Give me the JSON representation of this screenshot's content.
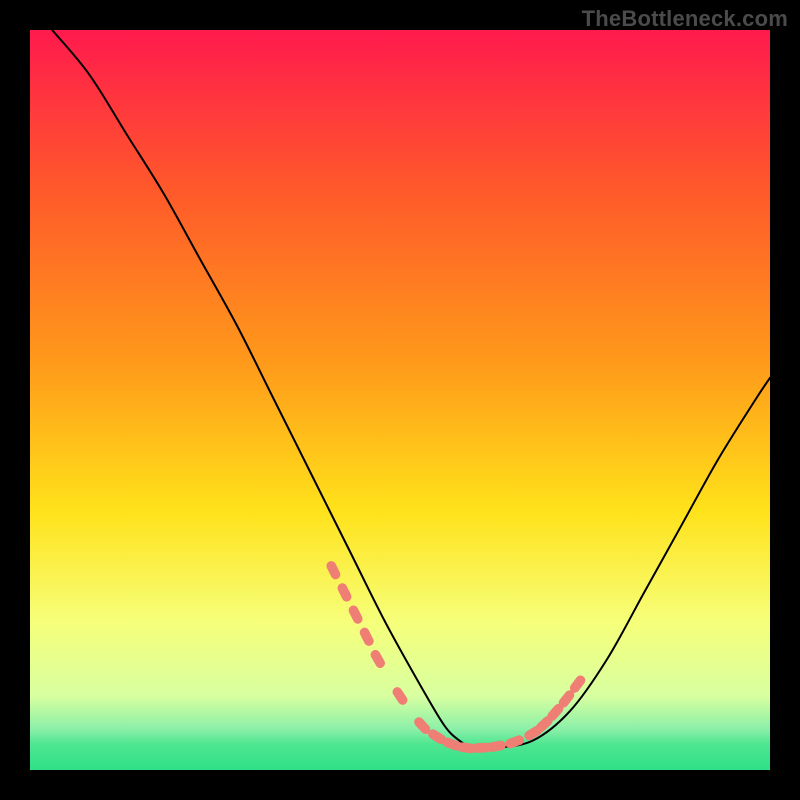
{
  "watermark": {
    "text": "TheBottleneck.com"
  },
  "colors": {
    "black": "#000000",
    "curve_stroke": "#000000",
    "marker_fill": "#ef7e74",
    "grad_top": "#ff1a4d",
    "grad_mid1": "#ff8a1a",
    "grad_mid2": "#ffe21a",
    "grad_low1": "#f6ff7a",
    "grad_low2": "#d8ffa0",
    "grad_bottom": "#2fe089"
  },
  "chart_data": {
    "type": "line",
    "title": "",
    "xlabel": "",
    "ylabel": "",
    "xlim": [
      0,
      100
    ],
    "ylim": [
      0,
      100
    ],
    "series": [
      {
        "name": "bottleneck-curve",
        "x": [
          3,
          8,
          13,
          18,
          23,
          28,
          33,
          38,
          43,
          48,
          53,
          56,
          58,
          60,
          63,
          68,
          73,
          78,
          83,
          88,
          93,
          98,
          100
        ],
        "y": [
          100,
          94,
          86,
          78,
          69,
          60,
          50,
          40,
          30,
          20,
          11,
          6,
          4,
          3,
          3,
          4,
          8,
          15,
          24,
          33,
          42,
          50,
          53
        ]
      }
    ],
    "markers": {
      "name": "highlight-dots",
      "x": [
        41,
        42.5,
        44,
        45.5,
        47,
        50,
        53,
        55,
        57,
        59,
        61,
        63,
        65.5,
        68,
        69.5,
        71,
        72.5,
        74
      ],
      "y": [
        27,
        24,
        21,
        18,
        15,
        10,
        6,
        4.5,
        3.5,
        3,
        3,
        3.2,
        3.8,
        5,
        6.2,
        7.8,
        9.6,
        11.6
      ]
    },
    "gradient_stops": [
      {
        "offset": 0.0,
        "color": "#ff1a4d"
      },
      {
        "offset": 0.22,
        "color": "#ff5a2a"
      },
      {
        "offset": 0.45,
        "color": "#ff9a1a"
      },
      {
        "offset": 0.65,
        "color": "#ffe21a"
      },
      {
        "offset": 0.8,
        "color": "#f6ff7a"
      },
      {
        "offset": 0.9,
        "color": "#d8ffa0"
      },
      {
        "offset": 0.945,
        "color": "#8af0a8"
      },
      {
        "offset": 0.965,
        "color": "#4fe690"
      },
      {
        "offset": 1.0,
        "color": "#2fe089"
      }
    ]
  }
}
